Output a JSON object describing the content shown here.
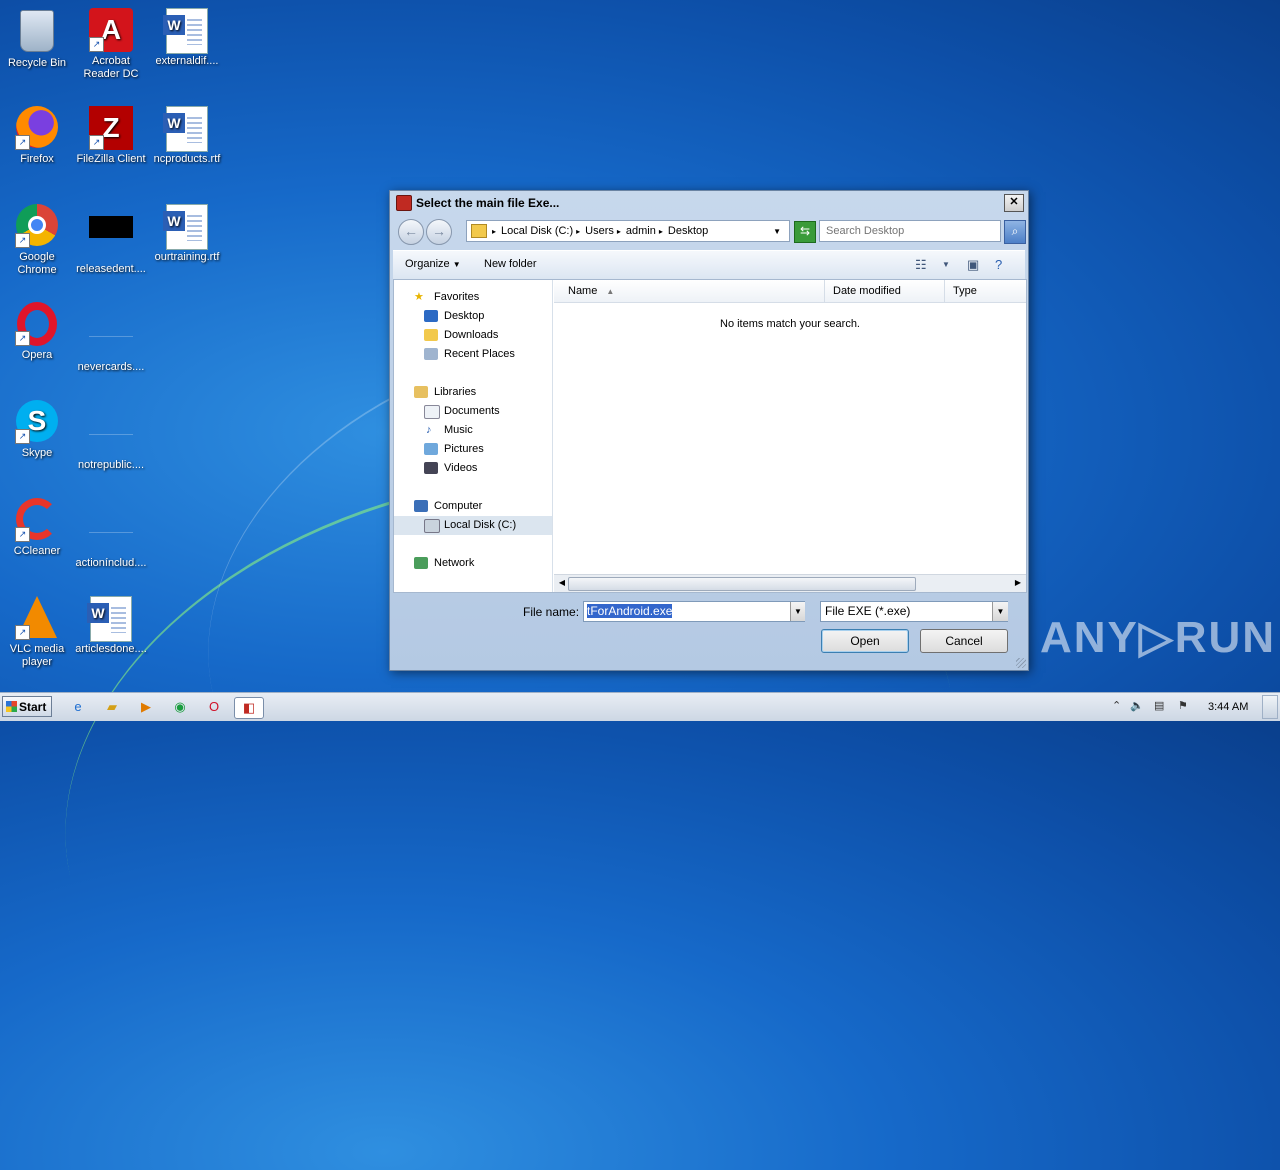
{
  "desktop": {
    "icons": [
      {
        "label": "Recycle Bin"
      },
      {
        "label": "Acrobat Reader DC"
      },
      {
        "label": "externaldif...."
      },
      {
        "label": "Firefox"
      },
      {
        "label": "FileZilla Client"
      },
      {
        "label": "ncproducts.rtf"
      },
      {
        "label": "Google Chrome"
      },
      {
        "label": "releasedent...."
      },
      {
        "label": "ourtraining.rtf"
      },
      {
        "label": "Opera"
      },
      {
        "label": "nevercards...."
      },
      {
        "label": "Skype"
      },
      {
        "label": "notrepublic...."
      },
      {
        "label": "CCleaner"
      },
      {
        "label": "actionínclud...."
      },
      {
        "label": "VLC media player"
      },
      {
        "label": "articlesdone...."
      }
    ]
  },
  "dialog": {
    "title": "Select the main file Exe...",
    "breadcrumb": [
      "Local Disk (C:)",
      "Users",
      "admin",
      "Desktop"
    ],
    "search_placeholder": "Search Desktop",
    "toolbar": {
      "organize": "Organize",
      "new_folder": "New folder"
    },
    "nav": {
      "favorites": "Favorites",
      "desktop": "Desktop",
      "downloads": "Downloads",
      "recent": "Recent Places",
      "libraries": "Libraries",
      "documents": "Documents",
      "music": "Music",
      "pictures": "Pictures",
      "videos": "Videos",
      "computer": "Computer",
      "local_disk": "Local Disk (C:)",
      "network": "Network"
    },
    "columns": {
      "name": "Name",
      "date": "Date modified",
      "type": "Type"
    },
    "empty_message": "No items match your search.",
    "file_name_label": "File name:",
    "file_name_value": "tForAndroid.exe",
    "file_type": "File EXE (*.exe)",
    "open": "Open",
    "cancel": "Cancel"
  },
  "watermark": "ANY▷RUN",
  "taskbar": {
    "start": "Start",
    "clock": "3:44 AM"
  }
}
